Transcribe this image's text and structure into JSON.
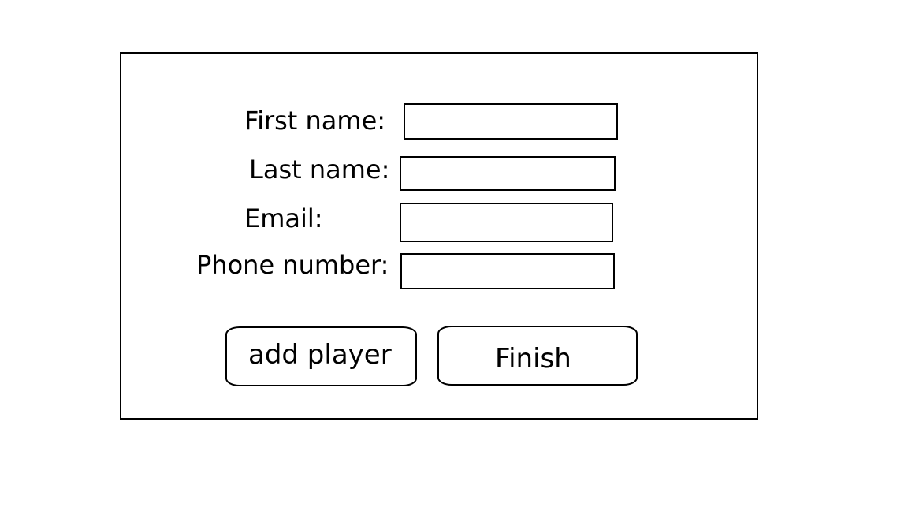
{
  "form": {
    "fields": [
      {
        "label": "First name:",
        "value": "",
        "placeholder": ""
      },
      {
        "label": "Last name:",
        "value": "",
        "placeholder": ""
      },
      {
        "label": "Email:",
        "value": "",
        "placeholder": ""
      },
      {
        "label": "Phone number:",
        "value": "",
        "placeholder": ""
      }
    ],
    "buttons": {
      "add_player_label": "add player",
      "finish_label": "Finish"
    }
  }
}
